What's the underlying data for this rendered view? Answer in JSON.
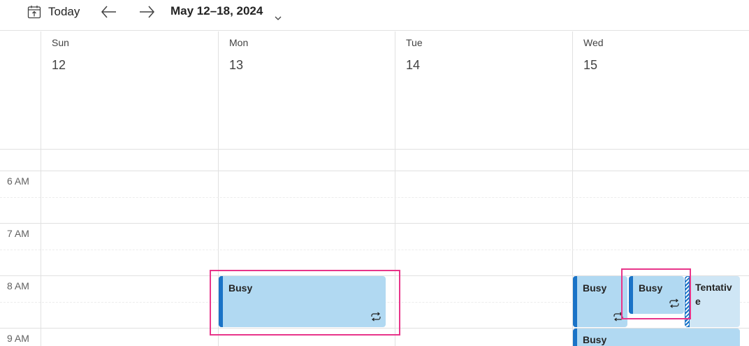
{
  "toolbar": {
    "today_label": "Today",
    "date_range": "May 12–18, 2024",
    "icons": [
      "calendar-today-icon",
      "arrow-left-icon",
      "arrow-right-icon",
      "chevron-down-icon"
    ]
  },
  "days": [
    {
      "name": "Sun",
      "number": "12"
    },
    {
      "name": "Mon",
      "number": "13"
    },
    {
      "name": "Tue",
      "number": "14"
    },
    {
      "name": "Wed",
      "number": "15"
    }
  ],
  "time_labels": [
    "6 AM",
    "7 AM",
    "8 AM",
    "9 AM"
  ],
  "events": {
    "mon_busy": {
      "title": "Busy",
      "recurring": true
    },
    "wed_busy_1": {
      "title": "Busy",
      "recurring": true
    },
    "wed_busy_2": {
      "title": "Busy",
      "recurring": true
    },
    "wed_tentative": {
      "title": "Tentative",
      "recurring": false
    },
    "wed_busy_3": {
      "title": "Busy",
      "recurring": false
    }
  },
  "colors": {
    "event_fill": "#b1d9f2",
    "event_accent": "#1a73c7",
    "tentative_fill": "#cfe6f5",
    "highlight": "#e8358a",
    "grid_line": "#e1e1e1"
  }
}
